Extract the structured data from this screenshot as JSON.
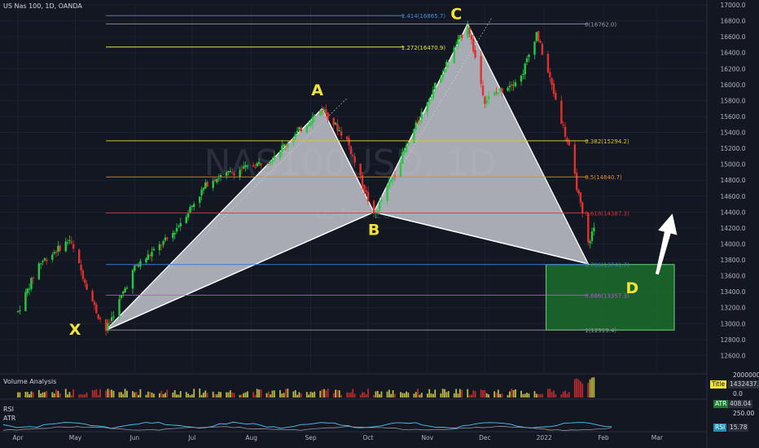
{
  "header": {
    "symbol_title": "US Nas 100, 1D, OANDA"
  },
  "watermark": {
    "symbol": "NAS100USD, 1D",
    "name": "US Nas 100"
  },
  "panels": {
    "volume_label": "Volume Analysis",
    "volume_axis_top": "2000000.0",
    "volume_axis_zero": "0.0",
    "volume_tag_label": "Title",
    "volume_tag_value": "1432437.0",
    "rsi_label": "RSI",
    "atr_label": "ATR",
    "atr_tag_label": "ATR",
    "atr_tag_value": "408.04",
    "atr_axis": "250.00",
    "rsi_tag_label": "RSI",
    "rsi_tag_value": "15.78"
  },
  "colors": {
    "background": "#131722",
    "bull_candle": "#26c941",
    "bear_candle": "#e0312e",
    "pattern_fill": "#c9ccd3",
    "target_zone": "#1e7a2e",
    "label_yellow": "#f2e23a",
    "arrow": "#ffffff"
  },
  "chart_data": {
    "type": "candlestick",
    "title": "US Nas 100, 1D, OANDA",
    "y_axis": {
      "ylim": [
        12400,
        17000
      ],
      "ticks": [
        12600,
        12800,
        13000,
        13200,
        13400,
        13600,
        13800,
        14000,
        14200,
        14400,
        14600,
        14800,
        15000,
        15200,
        15400,
        15600,
        15800,
        16000,
        16200,
        16400,
        16600,
        16800,
        17000
      ],
      "tick_labels": [
        "12600.0",
        "12800.0",
        "13000.0",
        "13200.0",
        "13400.0",
        "13600.0",
        "13800.0",
        "14000.0",
        "14200.0",
        "14400.0",
        "14600.0",
        "14800.0",
        "15000.0",
        "15200.0",
        "15400.0",
        "15600.0",
        "15800.0",
        "16000.0",
        "16200.0",
        "16400.0",
        "16600.0",
        "16800.0",
        "17000.0"
      ]
    },
    "x_axis": {
      "range": [
        "2021-04-01",
        "2022-03-10"
      ],
      "ticks": [
        "2021-04-01",
        "2021-05-01",
        "2021-06-01",
        "2021-07-01",
        "2021-08-01",
        "2021-09-01",
        "2021-10-01",
        "2021-11-01",
        "2021-12-01",
        "2022-01-01",
        "2022-02-01",
        "2022-03-01"
      ],
      "tick_labels": [
        "Apr",
        "May",
        "Jun",
        "Jul",
        "Aug",
        "Sep",
        "Oct",
        "Nov",
        "Dec",
        "2022",
        "Feb",
        "Mar"
      ]
    },
    "price_path": [
      {
        "date": "2021-04-01",
        "price": 13150
      },
      {
        "date": "2021-04-12",
        "price": 13750
      },
      {
        "date": "2021-04-28",
        "price": 14050
      },
      {
        "date": "2021-05-12",
        "price": 13150
      },
      {
        "date": "2021-05-17",
        "price": 12920
      },
      {
        "date": "2021-06-01",
        "price": 13700
      },
      {
        "date": "2021-06-20",
        "price": 14100
      },
      {
        "date": "2021-07-10",
        "price": 14800
      },
      {
        "date": "2021-08-10",
        "price": 15050
      },
      {
        "date": "2021-09-07",
        "price": 15700
      },
      {
        "date": "2021-09-20",
        "price": 15300
      },
      {
        "date": "2021-10-04",
        "price": 14350
      },
      {
        "date": "2021-10-15",
        "price": 14900
      },
      {
        "date": "2021-11-01",
        "price": 15800
      },
      {
        "date": "2021-11-22",
        "price": 16762
      },
      {
        "date": "2021-12-01",
        "price": 15800
      },
      {
        "date": "2021-12-20",
        "price": 16100
      },
      {
        "date": "2021-12-28",
        "price": 16650
      },
      {
        "date": "2022-01-06",
        "price": 15900
      },
      {
        "date": "2022-01-14",
        "price": 15200
      },
      {
        "date": "2022-01-24",
        "price": 14000
      },
      {
        "date": "2022-01-27",
        "price": 14200
      }
    ],
    "harmonic_pattern": {
      "points": [
        {
          "label": "X",
          "date": "2021-05-17",
          "price": 12919
        },
        {
          "label": "A",
          "date": "2021-09-07",
          "price": 15700
        },
        {
          "label": "B",
          "date": "2021-10-04",
          "price": 14400
        },
        {
          "label": "C",
          "date": "2021-11-22",
          "price": 16762
        },
        {
          "label": "D",
          "date": "2022-01-24",
          "price": 13750
        }
      ]
    },
    "fib_levels": [
      {
        "label": "1.414(16865.7)",
        "price": 16865.7,
        "color": "#4a90d9",
        "from": "2021-05-17",
        "to": "2021-10-20"
      },
      {
        "label": "0(16762.0)",
        "price": 16762.0,
        "color": "#9598a1",
        "from": "2021-05-17",
        "to": "2022-01-24"
      },
      {
        "label": "1.272(16470.9)",
        "price": 16470.9,
        "color": "#e6e24a",
        "from": "2021-05-17",
        "to": "2021-10-20"
      },
      {
        "label": "0.382(15294.2)",
        "price": 15294.2,
        "color": "#d9c23a",
        "from": "2021-05-17",
        "to": "2022-01-24"
      },
      {
        "label": "0.5(14840.7)",
        "price": 14840.7,
        "color": "#e08c2a",
        "from": "2021-05-17",
        "to": "2022-01-24"
      },
      {
        "label": "0.618(14387.3)",
        "price": 14387.3,
        "color": "#e0312e",
        "from": "2021-05-17",
        "to": "2022-01-24"
      },
      {
        "label": "0.786(13741.7)",
        "price": 13741.7,
        "color": "#3a7bd5",
        "from": "2021-05-17",
        "to": "2022-01-24"
      },
      {
        "label": "0.886(13357.3)",
        "price": 13357.3,
        "color": "#b35ad6",
        "from": "2021-05-17",
        "to": "2022-01-24"
      },
      {
        "label": "1(12919.4)",
        "price": 12919.4,
        "color": "#9598a1",
        "from": "2021-05-17",
        "to": "2022-01-24"
      }
    ],
    "target_zone": {
      "date_from": "2022-01-02",
      "date_to": "2022-03-10",
      "price_top": 13741.7,
      "price_bottom": 12919.4
    },
    "annotation_arrow": {
      "from": {
        "date": "2022-03-01",
        "price": 13620
      },
      "to": {
        "date": "2022-03-09",
        "price": 14380
      }
    }
  }
}
